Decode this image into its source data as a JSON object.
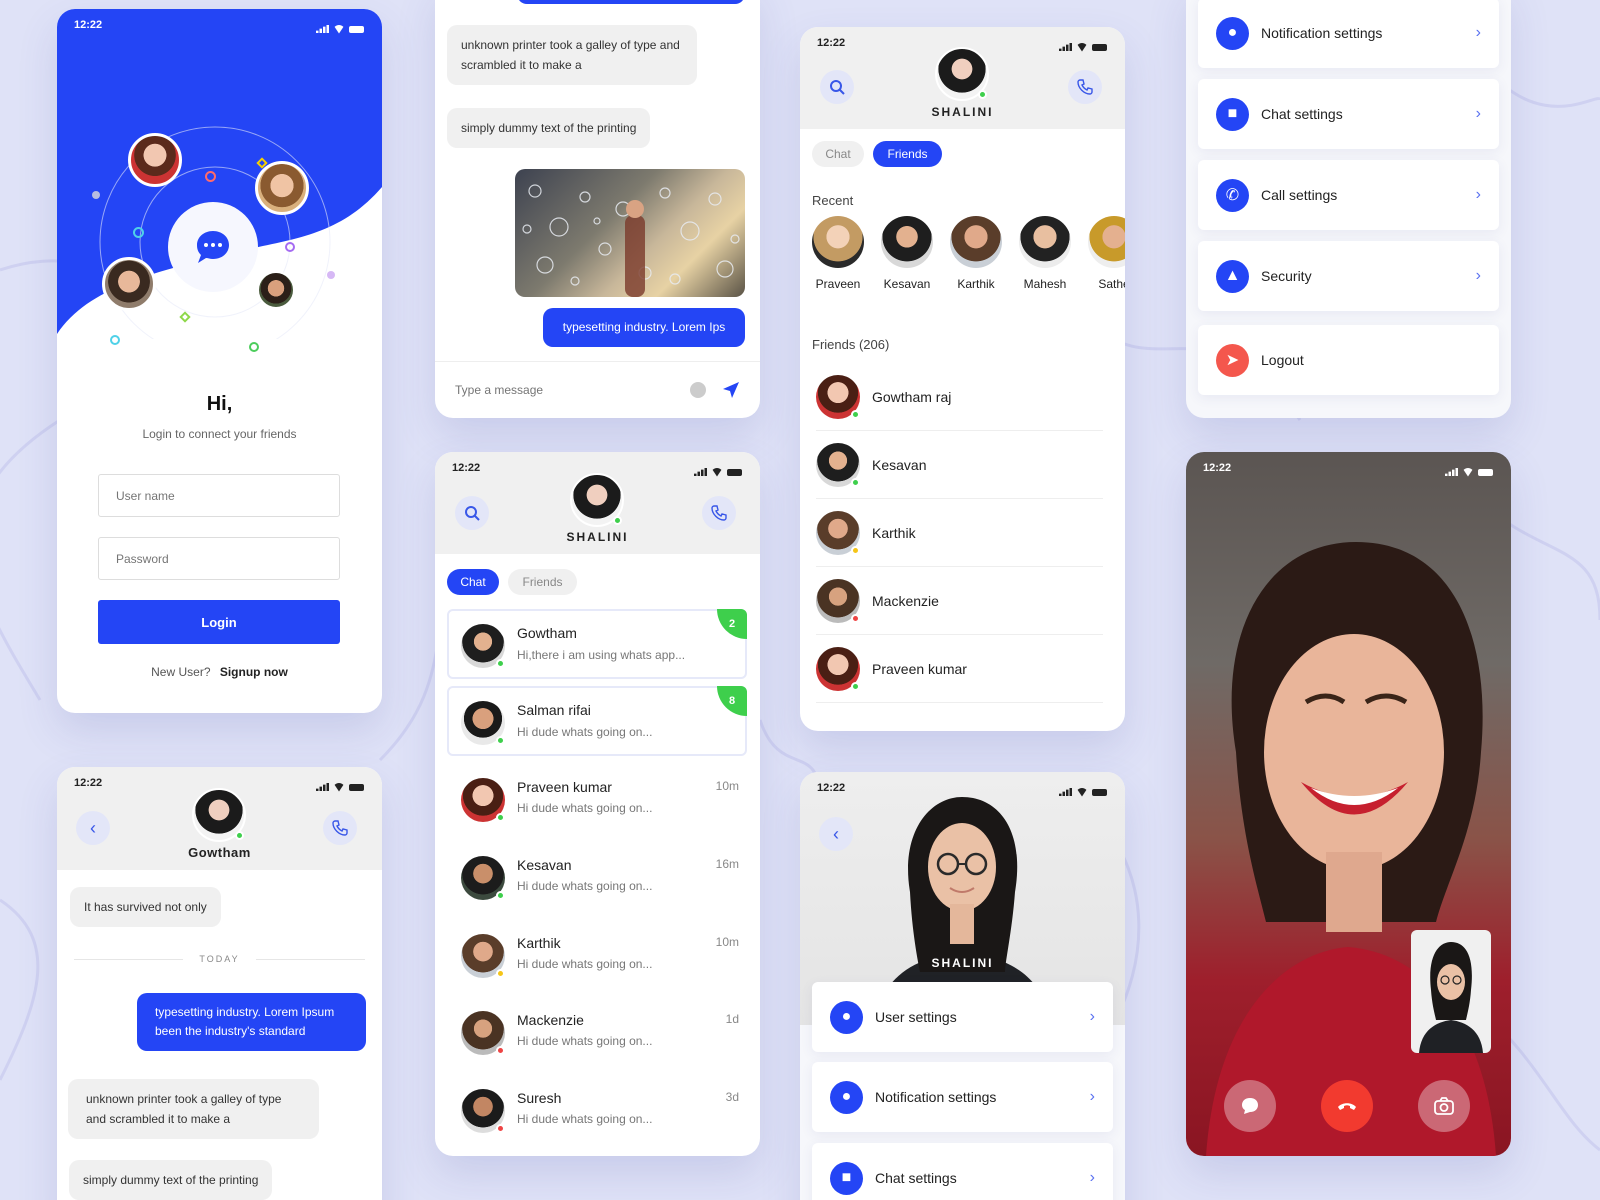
{
  "colors": {
    "accent": "#2445f5",
    "online": "#3ecf4c",
    "away": "#f5c518",
    "busy": "#ee4444",
    "background": "#dfe2f7",
    "danger": "#f23a2f"
  },
  "status_time": "12:22",
  "login": {
    "greeting": "Hi,",
    "subtitle": "Login to connect your friends",
    "username_placeholder": "User name",
    "password_placeholder": "Password",
    "login_button": "Login",
    "new_user": "New User?",
    "signup": "Signup now"
  },
  "chat_thread": {
    "messages": [
      {
        "text": "unknown printer took a galley of type and scrambled it to make a"
      },
      {
        "text": "simply dummy text of the printing"
      },
      {
        "text": "typesetting industry. Lorem Ips"
      }
    ],
    "input_placeholder": "Type a message",
    "emoji_icon": "smiley-icon",
    "send_icon": "send-icon"
  },
  "friends_screen": {
    "profile_name": "SHALINI",
    "tabs": [
      "Chat",
      "Friends"
    ],
    "recent_label": "Recent",
    "recent": [
      "Praveen",
      "Kesavan",
      "Karthik",
      "Mahesh",
      "Sathe"
    ],
    "friends_label": "Friends (206)",
    "friends": [
      {
        "name": "Gowtham raj",
        "status": "online"
      },
      {
        "name": "Kesavan",
        "status": "online"
      },
      {
        "name": "Karthik",
        "status": "away"
      },
      {
        "name": "Mackenzie",
        "status": "busy"
      },
      {
        "name": "Praveen kumar",
        "status": "online"
      }
    ]
  },
  "settings_top": [
    {
      "label": "Notification settings",
      "icon": "bell-icon"
    },
    {
      "label": "Chat settings",
      "icon": "chat-icon"
    },
    {
      "label": "Call settings",
      "icon": "phone-icon"
    },
    {
      "label": "Security",
      "icon": "lock-icon"
    },
    {
      "label": "Logout",
      "icon": "logout-icon"
    }
  ],
  "conversation": {
    "contact": "Gowtham",
    "messages": [
      {
        "text": "It has survived not only"
      },
      {
        "text": "typesetting industry. Lorem Ipsum been the industry's standard"
      },
      {
        "text": "unknown printer took a galley of type and scrambled it to make a"
      },
      {
        "text": "simply dummy text of the printing"
      }
    ],
    "divider": "TODAY"
  },
  "chat_list": {
    "profile_name": "SHALINI",
    "tabs": [
      "Chat",
      "Friends"
    ],
    "items": [
      {
        "name": "Gowtham",
        "preview": "Hi,there i am using whats app...",
        "badge": "2",
        "time": "",
        "status": "online"
      },
      {
        "name": "Salman rifai",
        "preview": "Hi dude whats going on...",
        "badge": "8",
        "time": "",
        "status": "online"
      },
      {
        "name": "Praveen kumar",
        "preview": "Hi dude whats going on...",
        "badge": "",
        "time": "10m",
        "status": "online"
      },
      {
        "name": "Kesavan",
        "preview": "Hi dude whats going on...",
        "badge": "",
        "time": "16m",
        "status": "online"
      },
      {
        "name": "Karthik",
        "preview": "Hi dude whats going on...",
        "badge": "",
        "time": "10m",
        "status": "away"
      },
      {
        "name": "Mackenzie",
        "preview": "Hi dude whats going on...",
        "badge": "",
        "time": "1d",
        "status": "busy"
      },
      {
        "name": "Suresh",
        "preview": "Hi dude whats going on...",
        "badge": "",
        "time": "3d",
        "status": "busy"
      }
    ]
  },
  "profile_settings": {
    "name": "SHALINI",
    "items": [
      {
        "label": "User settings",
        "icon": "user-icon"
      },
      {
        "label": "Notification settings",
        "icon": "bell-icon"
      },
      {
        "label": "Chat settings",
        "icon": "chat-icon"
      }
    ]
  },
  "video_call": {
    "controls": [
      "chat-icon",
      "end-call-icon",
      "switch-camera-icon"
    ]
  }
}
